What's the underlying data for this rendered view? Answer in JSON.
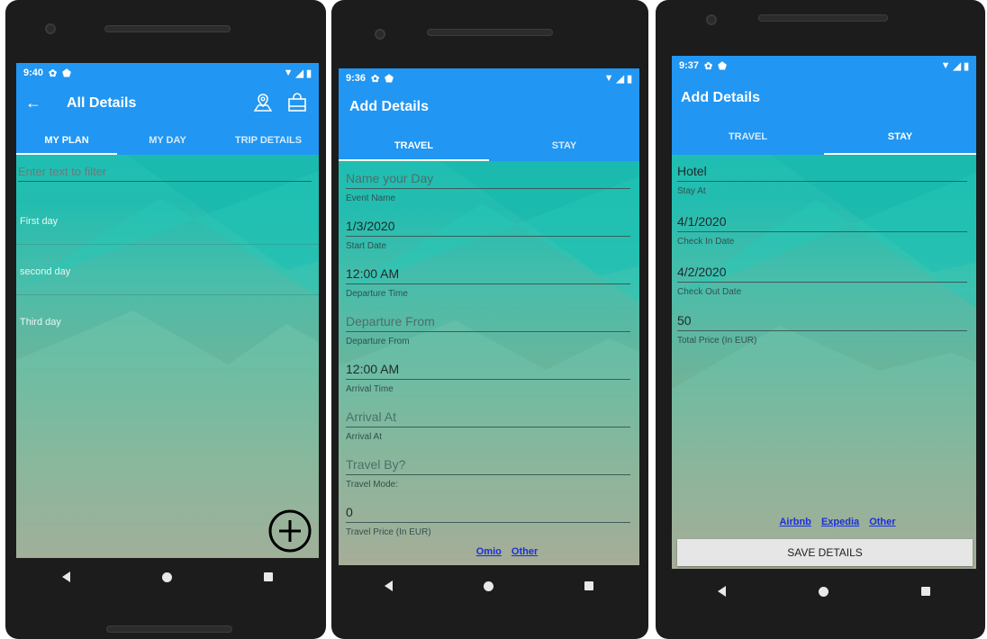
{
  "phones": [
    {
      "status": {
        "time": "9:40"
      },
      "header": {
        "title": "All Details"
      },
      "tabs": [
        {
          "label": "MY PLAN",
          "active": true
        },
        {
          "label": "MY DAY",
          "active": false
        },
        {
          "label": "TRIP DETAILS",
          "active": false
        }
      ],
      "filter": {
        "placeholder": "Enter text to filter"
      },
      "list": [
        "First day",
        "second day",
        "Third day"
      ]
    },
    {
      "status": {
        "time": "9:36"
      },
      "header": {
        "title": "Add Details"
      },
      "tabs": [
        {
          "label": "TRAVEL",
          "active": true
        },
        {
          "label": "STAY",
          "active": false
        }
      ],
      "fields": [
        {
          "value": "Name your Day",
          "placeholder": true,
          "label": "Event Name"
        },
        {
          "value": "1/3/2020",
          "placeholder": false,
          "label": "Start Date"
        },
        {
          "value": "12:00 AM",
          "placeholder": false,
          "label": "Departure Time"
        },
        {
          "value": "Departure From",
          "placeholder": true,
          "label": "Departure From"
        },
        {
          "value": "12:00 AM",
          "placeholder": false,
          "label": "Arrival Time"
        },
        {
          "value": "Arrival At",
          "placeholder": true,
          "label": "Arrival At"
        },
        {
          "value": "Travel By?",
          "placeholder": true,
          "label": "Travel Mode:"
        },
        {
          "value": "0",
          "placeholder": false,
          "label": "Travel Price (In EUR)"
        }
      ],
      "links": [
        "Omio",
        "Other"
      ]
    },
    {
      "status": {
        "time": "9:37"
      },
      "header": {
        "title": "Add Details"
      },
      "tabs": [
        {
          "label": "TRAVEL",
          "active": false
        },
        {
          "label": "STAY",
          "active": true
        }
      ],
      "fields": [
        {
          "value": "Hotel",
          "placeholder": false,
          "label": "Stay At"
        },
        {
          "value": "4/1/2020",
          "placeholder": false,
          "label": "Check In Date"
        },
        {
          "value": "4/2/2020",
          "placeholder": false,
          "label": "Check Out Date"
        },
        {
          "value": "50",
          "placeholder": false,
          "label": "Total Price (In EUR)"
        }
      ],
      "links": [
        "Airbnb",
        "Expedia",
        "Other"
      ],
      "save_button": "SAVE DETAILS"
    }
  ],
  "colors": {
    "app_bar": "#2196f3",
    "link": "#1a2fd8",
    "save_button_bg": "#e6e6e6"
  },
  "icons": {
    "back": "arrow-left-icon",
    "map": "map-location-icon",
    "bag": "shopping-bag-icon",
    "add": "add-circle-icon",
    "settings": "gear-icon",
    "shield": "shield-icon",
    "wifi": "wifi-icon",
    "signal": "signal-icon",
    "battery": "battery-icon"
  }
}
